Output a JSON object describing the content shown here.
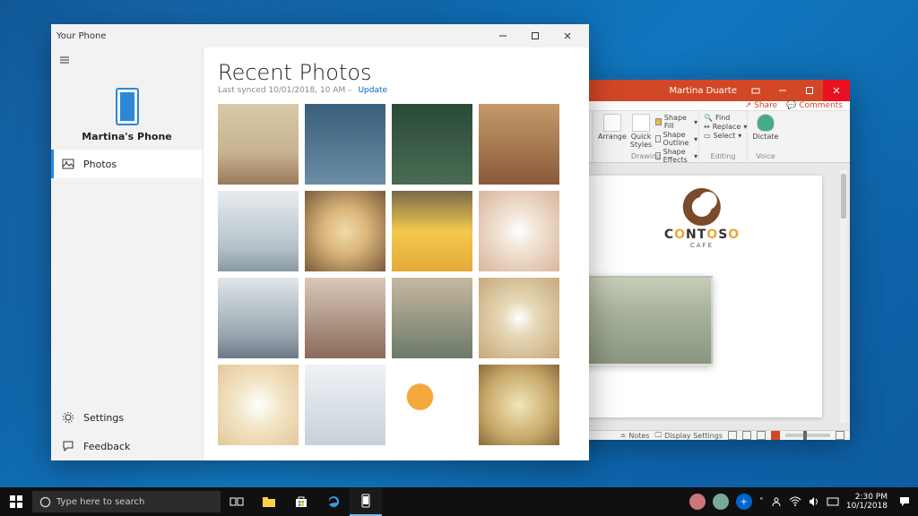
{
  "your_phone": {
    "title": "Your Phone",
    "phone_label": "Martina's Phone",
    "nav_photos": "Photos",
    "nav_settings": "Settings",
    "nav_feedback": "Feedback",
    "heading": "Recent Photos",
    "sync_prefix": "Last synced 10/01/2018, 10 AM – ",
    "sync_action": "Update"
  },
  "powerpoint": {
    "user": "Martina Duarte",
    "share": "Share",
    "comments": "Comments",
    "ribbon": {
      "arrange": "Arrange",
      "quick_styles": "Quick\nStyles",
      "shape_fill": "Shape Fill",
      "shape_outline": "Shape Outline",
      "shape_effects": "Shape Effects",
      "find": "Find",
      "replace": "Replace",
      "select": "Select",
      "dictate": "Dictate",
      "grp_drawing": "Drawing",
      "grp_editing": "Editing",
      "grp_voice": "Voice"
    },
    "slide": {
      "logo_main": "CONTOSO",
      "logo_sub": "CAFE"
    },
    "status": {
      "notes": "Notes",
      "display": "Display Settings"
    }
  },
  "taskbar": {
    "search_placeholder": "Type here to search",
    "time": "2:30 PM",
    "date": "10/1/2018"
  }
}
